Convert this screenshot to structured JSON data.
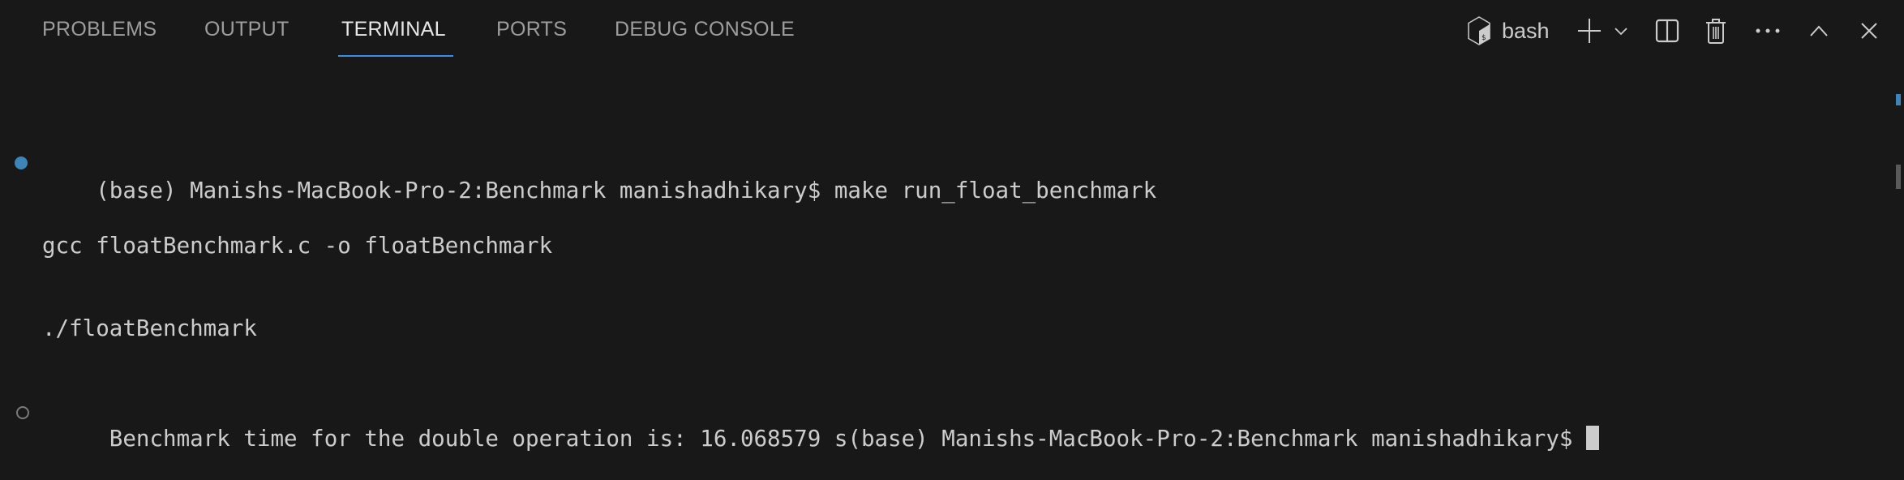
{
  "tabs": [
    {
      "label": "PROBLEMS",
      "active": false
    },
    {
      "label": "OUTPUT",
      "active": false
    },
    {
      "label": "TERMINAL",
      "active": true
    },
    {
      "label": "PORTS",
      "active": false
    },
    {
      "label": "DEBUG CONSOLE",
      "active": false
    }
  ],
  "toolbar": {
    "shell_icon": "bash-icon",
    "shell_label": "bash",
    "icons": [
      "plus-icon",
      "chevron-down-icon",
      "split-icon",
      "trash-icon",
      "more-icon",
      "maximize-icon",
      "close-icon"
    ]
  },
  "terminal": {
    "lines": [
      {
        "decoration": "success",
        "text": "(base) Manishs-MacBook-Pro-2:Benchmark manishadhikary$ make run_float_benchmark"
      },
      {
        "decoration": "none",
        "text": "gcc floatBenchmark.c -o floatBenchmark"
      },
      {
        "decoration": "none",
        "text": "./floatBenchmark"
      },
      {
        "decoration": "empty",
        "text": " Benchmark time for the double operation is: 16.068579 s(base) Manishs-MacBook-Pro-2:Benchmark manishadhikary$ "
      }
    ]
  },
  "colors": {
    "accent": "#3a8ee6",
    "success_dot": "#3d85b8",
    "background": "#181818"
  }
}
